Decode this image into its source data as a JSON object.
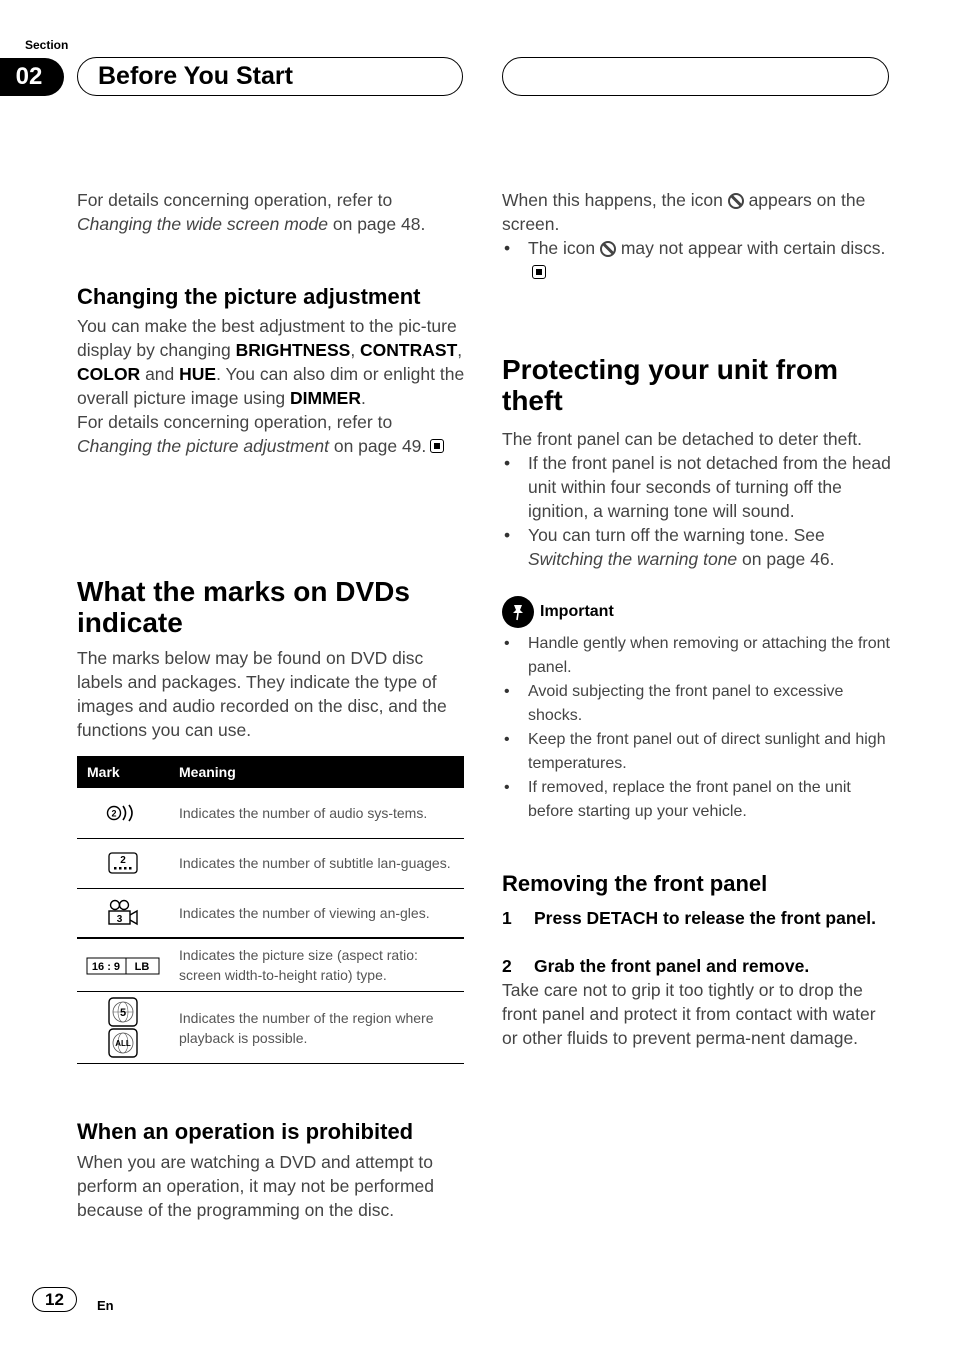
{
  "header": {
    "section_label": "Section",
    "section_number": "02",
    "title": "Before You Start"
  },
  "left": {
    "intro": {
      "text1": "For details concerning operation, refer to",
      "link": "Changing the wide screen mode",
      "text2": " on page 48."
    },
    "picture_adjustment": {
      "heading": "Changing the picture adjustment",
      "p1": "You can make the best adjustment to the pic-ture display by changing ",
      "brightness": "BRIGHTNESS",
      "comma1": ", ",
      "contrast": "CONTRAST",
      "comma2": ", ",
      "color": "COLOR",
      "and": " and ",
      "hue": "HUE",
      "p2": ". You can also dim or enlight the overall picture image using ",
      "dimmer": "DIMMER",
      "period": ".",
      "ref1": "For details concerning operation, refer to ",
      "ref_link": "Changing the picture adjustment",
      "ref2": " on page 49."
    },
    "dvd_marks": {
      "heading": "What the marks on DVDs indicate",
      "body": "The marks below may be found on DVD disc labels and packages. They indicate the type of images and audio recorded on the disc, and the functions you can use.",
      "table": {
        "headers": [
          "Mark",
          "Meaning"
        ],
        "rows": [
          {
            "icon": "audio-systems-icon",
            "label": "2",
            "meaning": "Indicates the number of audio sys-tems."
          },
          {
            "icon": "subtitle-languages-icon",
            "label": "2",
            "meaning": "Indicates the number of subtitle lan-guages."
          },
          {
            "icon": "viewing-angles-icon",
            "label": "3",
            "meaning": "Indicates the number of viewing an-gles."
          },
          {
            "icon": "aspect-ratio-icon",
            "label": "16 : 9",
            "label2": "LB",
            "meaning": "Indicates the picture size (aspect ratio: screen width-to-height ratio) type."
          },
          {
            "icon": "region-icon",
            "label": "5",
            "label2": "ALL",
            "meaning": "Indicates the number of the region where playback is possible."
          }
        ]
      }
    },
    "prohibited": {
      "heading": "When an operation is prohibited",
      "body": "When you are watching a DVD and attempt to perform an operation, it may not be performed because of the programming on the disc."
    }
  },
  "right": {
    "prohibited_cont": {
      "t1": "When this happens, the icon ",
      "t2": " appears on the screen.",
      "bullet1": "The icon ",
      "bullet2": " may not appear with certain discs."
    },
    "theft": {
      "heading": "Protecting your unit from theft",
      "body": "The front panel can be detached to deter theft.",
      "bullets": [
        "If the front panel is not detached from the head unit within four seconds of turning off the ignition, a warning tone will sound.",
        "You can turn off the warning tone. See "
      ],
      "bullet2_link": "Switching the warning tone",
      "bullet2_tail": " on page 46."
    },
    "important": {
      "label": "Important",
      "bullets": [
        "Handle gently when removing or attaching the front panel.",
        "Avoid subjecting the front panel to excessive shocks.",
        "Keep the front panel out of direct sunlight and high temperatures.",
        "If removed, replace the front panel on the unit before starting up your vehicle."
      ]
    },
    "removing": {
      "heading": "Removing the front panel",
      "step1_num": "1",
      "step1": "Press DETACH to release the front panel.",
      "step2_num": "2",
      "step2": "Grab the front panel and remove.",
      "body": "Take care not to grip it too tightly or to drop the front panel and protect it from contact with water or other fluids to prevent perma-nent damage."
    }
  },
  "footer": {
    "page_number": "12",
    "language": "En"
  }
}
